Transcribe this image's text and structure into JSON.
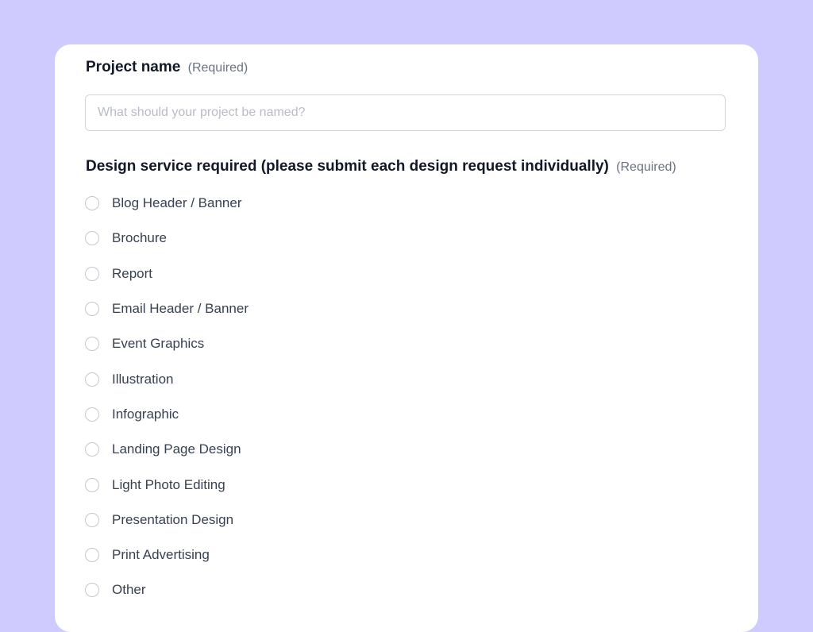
{
  "form": {
    "project_name": {
      "label": "Project name",
      "required_text": "(Required)",
      "placeholder": "What should your project be named?",
      "value": ""
    },
    "design_service": {
      "label": "Design service required (please submit each design request individually)",
      "required_text": "(Required)",
      "options": [
        {
          "label": "Blog Header / Banner",
          "selected": false
        },
        {
          "label": "Brochure",
          "selected": false
        },
        {
          "label": "Report",
          "selected": false
        },
        {
          "label": "Email Header / Banner",
          "selected": false
        },
        {
          "label": "Event Graphics",
          "selected": false
        },
        {
          "label": "Illustration",
          "selected": false
        },
        {
          "label": "Infographic",
          "selected": false
        },
        {
          "label": "Landing Page Design",
          "selected": false
        },
        {
          "label": "Light Photo Editing",
          "selected": false
        },
        {
          "label": "Presentation Design",
          "selected": false
        },
        {
          "label": "Print Advertising",
          "selected": false
        },
        {
          "label": "Other",
          "selected": false
        }
      ]
    }
  },
  "colors": {
    "background": "#cfcbff",
    "card": "#ffffff",
    "label_text": "#111827",
    "muted_text": "#6b7280",
    "input_border": "#d1d5db"
  }
}
